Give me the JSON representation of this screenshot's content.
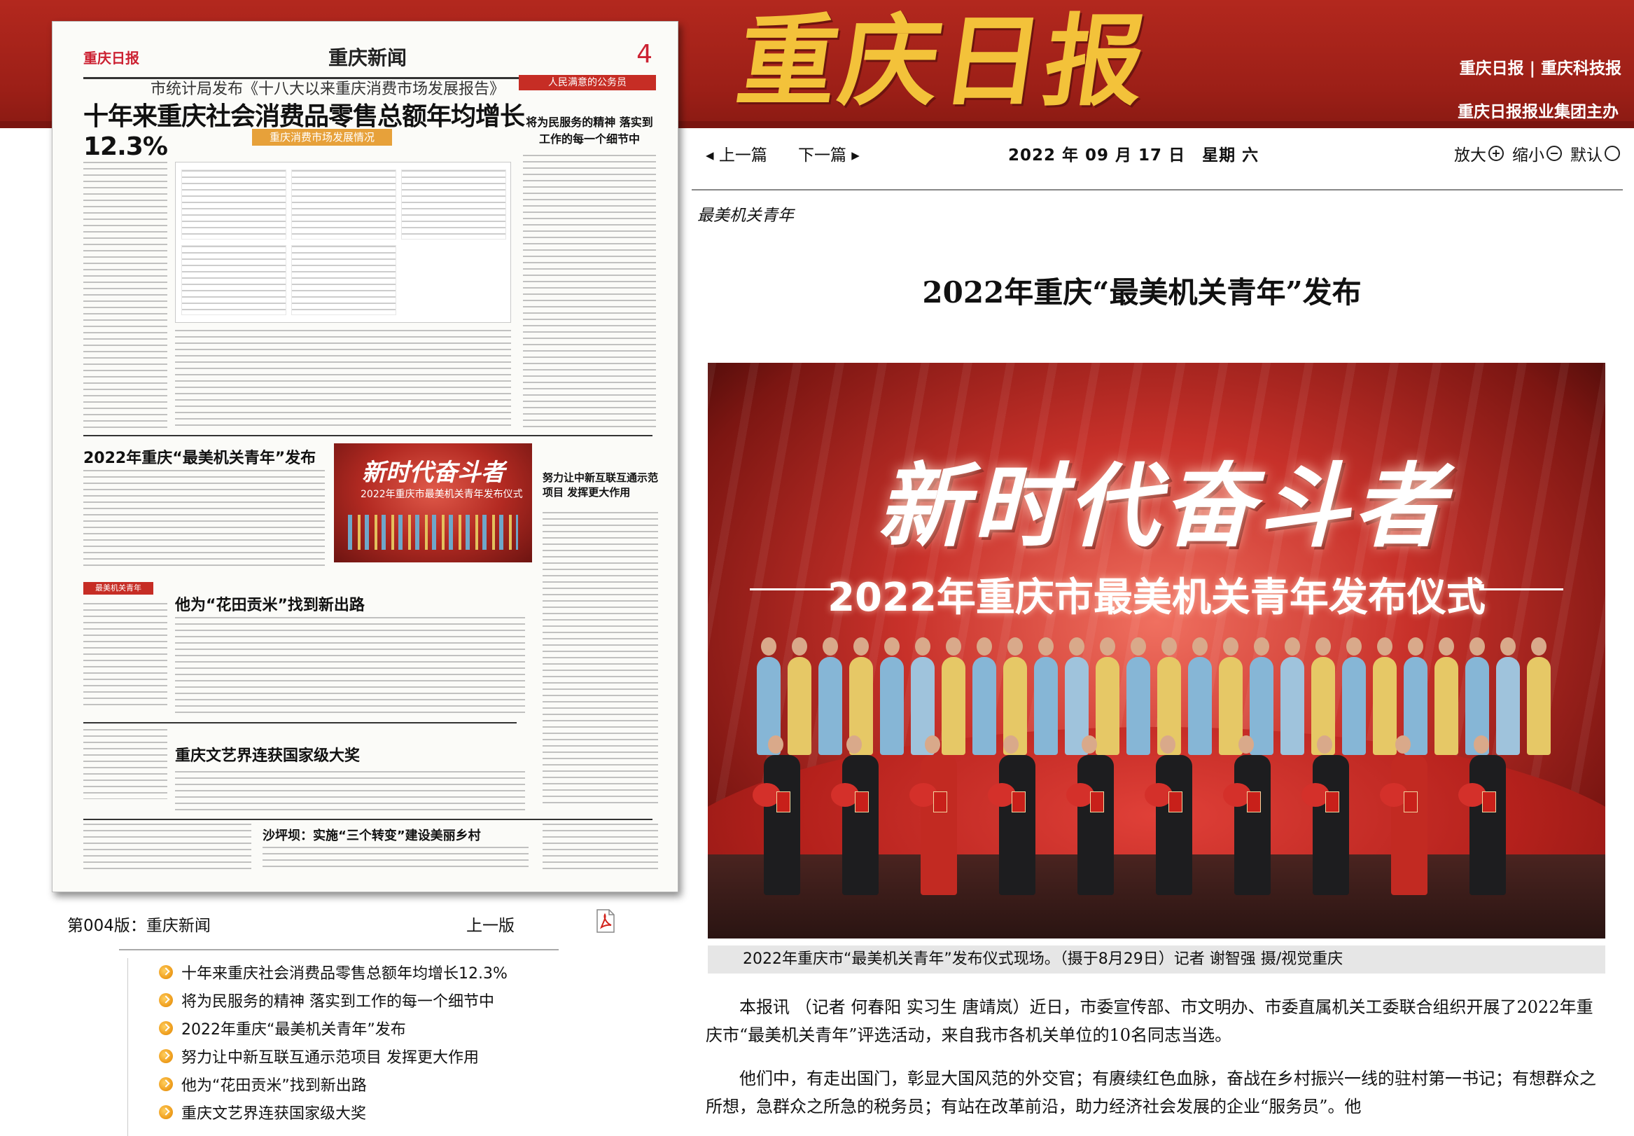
{
  "header": {
    "logo_text": "重庆日报",
    "links": "重庆日报 | 重庆科技报",
    "host": "重庆日报报业集团主办"
  },
  "newspaper_thumb": {
    "mini_logo": "重庆日报",
    "section": "重庆新闻",
    "page_num": "4",
    "kicker": "市统计局发布《十八大以来重庆消费市场发展报告》",
    "headline": "十年来重庆社会消费品零售总额年均增长12.3%",
    "info_tag": "重庆消费市场发展情况",
    "side_tag": "人民满意的公务员",
    "side_head": "将为民服务的精神 落实到工作的每一个细节中",
    "h2_youth": "2022年重庆“最美机关青年”发布",
    "photo_title": "新时代奋斗者",
    "photo_sub": "2022年重庆市最美机关青年发布仪式",
    "mid_head": "努力让中新互联互通示范项目 发挥更大作用",
    "tag_blue": "最美机关青年",
    "h2_rice": "他为“花田贡米”找到新出路",
    "h2_art": "重庆文艺界连获国家级大奖",
    "h2_village": "沙坪坝：实施“三个转变”建设美丽乡村"
  },
  "edition": {
    "label": "第004版：重庆新闻",
    "prev": "上一版",
    "pdf_icon": "pdf-icon"
  },
  "article_list": [
    "十年来重庆社会消费品零售总额年均增长12.3%",
    "将为民服务的精神 落实到工作的每一个细节中",
    "2022年重庆“最美机关青年”发布",
    "努力让中新互联互通示范项目 发挥更大作用",
    "他为“花田贡米”找到新出路",
    "重庆文艺界连获国家级大奖"
  ],
  "nav": {
    "prev": "上一篇",
    "next": "下一篇",
    "date": "2022 年 09 月 17 日　星期 六",
    "zoom_in": "放大",
    "zoom_out": "缩小",
    "default": "默认"
  },
  "article": {
    "column": "最美机关青年",
    "title": "2022年重庆“最美机关青年”发布",
    "photo_title": "新时代奋斗者",
    "photo_subtitle": "2022年重庆市最美机关青年发布仪式",
    "caption": "2022年重庆市“最美机关青年”发布仪式现场。（摄于8月29日）记者 谢智强 摄/视觉重庆",
    "para1": "本报讯 （记者 何春阳 实习生 唐靖岚）近日，市委宣传部、市文明办、市委直属机关工委联合组织开展了2022年重庆市“最美机关青年”评选活动，来自我市各机关单位的10名同志当选。",
    "para2": "他们中，有走出国门，彰显大国风范的外交官；有赓续红色血脉，奋战在乡村振兴一线的驻村第一书记；有想群众之所想，急群众之所急的税务员；有站在改革前沿，助力经济社会发展的企业“服务员”。他"
  },
  "colors": {
    "header_red": "#b3281e",
    "logo_gold": "#f3c23a",
    "bullet_orange": "#f0a020"
  }
}
